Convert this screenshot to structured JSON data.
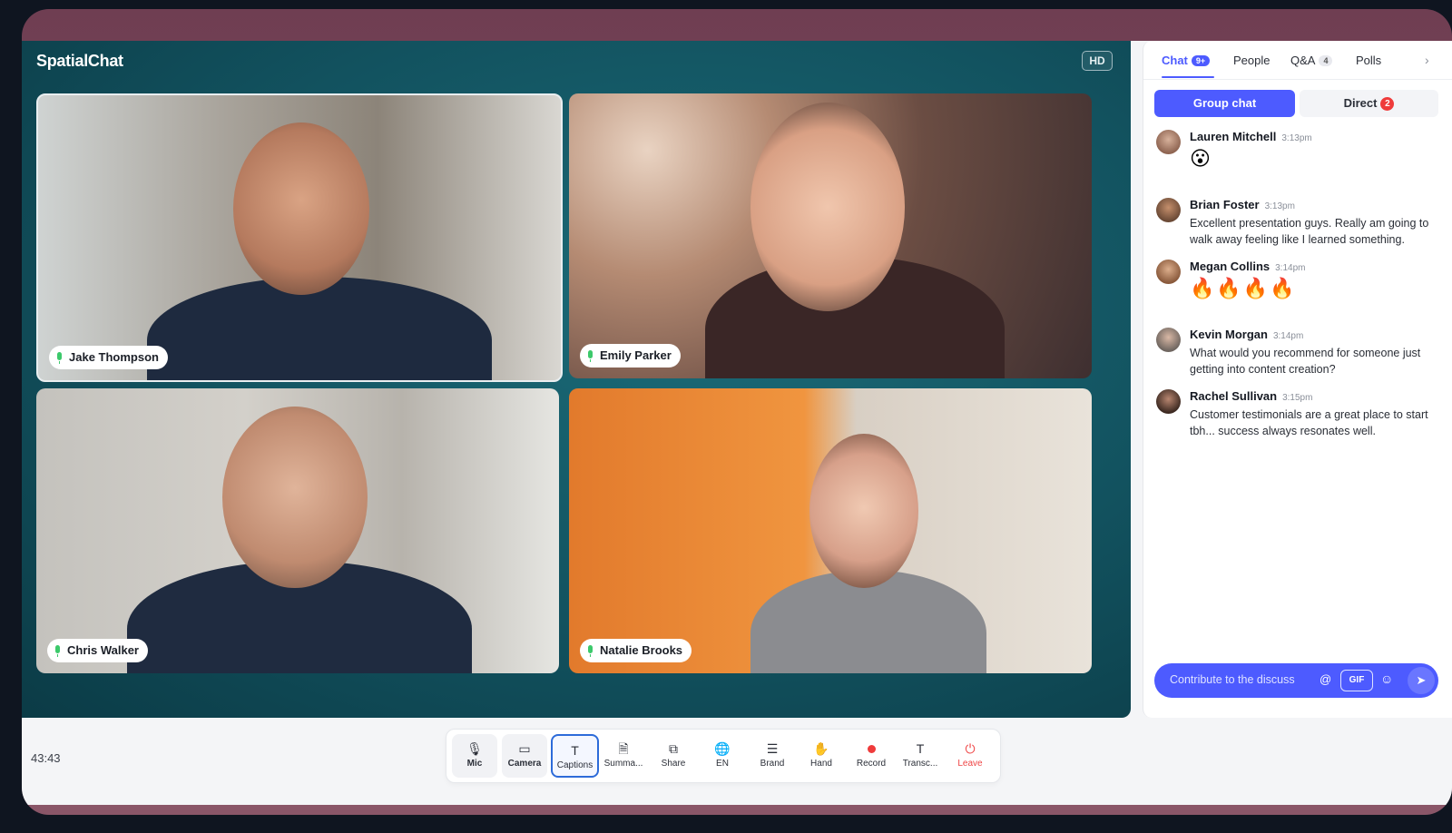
{
  "app": {
    "brand": "SpatialChat",
    "hd_label": "HD",
    "timer": "43:43"
  },
  "participants": [
    {
      "name": "Jake Thompson"
    },
    {
      "name": "Emily Parker"
    },
    {
      "name": "Chris Walker"
    },
    {
      "name": "Natalie Brooks"
    }
  ],
  "sidebar": {
    "tabs": [
      {
        "label": "Chat",
        "badge": "9+"
      },
      {
        "label": "People"
      },
      {
        "label": "Q&A",
        "badge": "4"
      },
      {
        "label": "Polls"
      }
    ],
    "segments": {
      "group": "Group chat",
      "direct": "Direct",
      "direct_badge": "2"
    },
    "messages": [
      {
        "author": "Lauren Mitchell",
        "time": "3:13pm",
        "text": "",
        "emoji": "😮"
      },
      {
        "author": "Brian Foster",
        "time": "3:13pm",
        "text": "Excellent presentation guys. Really am going to walk away feeling like I learned something.",
        "emoji": ""
      },
      {
        "author": "Megan Collins",
        "time": "3:14pm",
        "text": "",
        "emoji": "🔥🔥🔥🔥"
      },
      {
        "author": "Kevin Morgan",
        "time": "3:14pm",
        "text": "What would you recommend for someone just getting into content creation?",
        "emoji": ""
      },
      {
        "author": "Rachel Sullivan",
        "time": "3:15pm",
        "text": "Customer testimonials are a great place to start tbh... success always resonates well.",
        "emoji": ""
      }
    ],
    "composer": {
      "placeholder": "Contribute to the discuss",
      "at": "@",
      "gif": "GIF"
    }
  },
  "toolbar": {
    "items": [
      {
        "label": "Mic"
      },
      {
        "label": "Camera"
      },
      {
        "label": "Captions"
      },
      {
        "label": "Summa..."
      },
      {
        "label": "Share"
      },
      {
        "label": "EN"
      },
      {
        "label": "Brand"
      },
      {
        "label": "Hand"
      },
      {
        "label": "Record"
      },
      {
        "label": "Transc..."
      },
      {
        "label": "Leave"
      }
    ]
  },
  "colors": {
    "accent": "#4d5bff",
    "danger": "#ef4444",
    "stage": "#12525f"
  }
}
